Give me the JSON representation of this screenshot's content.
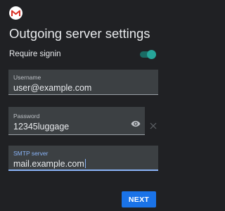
{
  "header": {
    "logo_icon": "gmail-logo-icon",
    "title": "Outgoing server settings"
  },
  "signin": {
    "label": "Require signin",
    "enabled": true
  },
  "fields": {
    "username": {
      "label": "Username",
      "value": "user@example.com"
    },
    "password": {
      "label": "Password",
      "value": "12345luggage",
      "toggle_icon": "eye-icon"
    },
    "smtp": {
      "label": "SMTP server",
      "value": "mail.example.com"
    }
  },
  "actions": {
    "next_label": "NEXT"
  },
  "colors": {
    "background": "#202124",
    "field_bg": "#3c4043",
    "accent": "#8ab4f8",
    "button": "#1a73e8",
    "toggle": "#26a69a"
  }
}
